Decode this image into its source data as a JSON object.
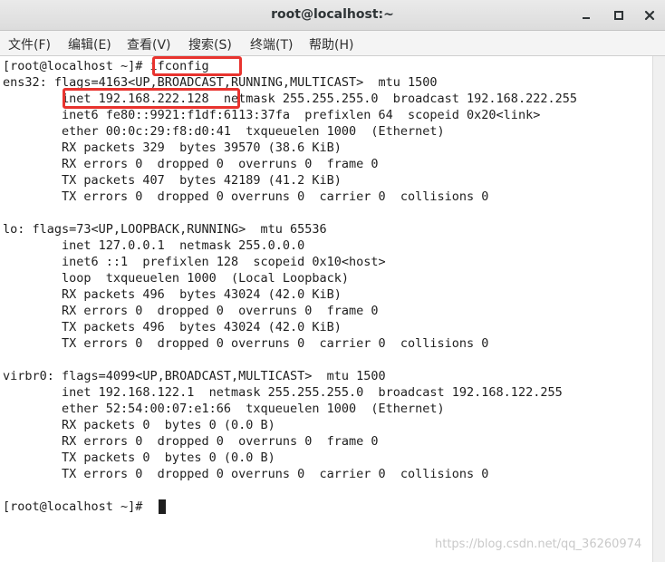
{
  "window": {
    "title": "root@localhost:~",
    "controls": [
      "minimize-icon",
      "maximize-icon",
      "close-icon"
    ]
  },
  "menu": [
    "文件(F)",
    "编辑(E)",
    "查看(V)",
    "搜索(S)",
    "终端(T)",
    "帮助(H)"
  ],
  "terminal": {
    "lines": [
      "[root@localhost ~]# ifconfig",
      "ens32: flags=4163<UP,BROADCAST,RUNNING,MULTICAST>  mtu 1500",
      "        inet 192.168.222.128  netmask 255.255.255.0  broadcast 192.168.222.255",
      "        inet6 fe80::9921:f1df:6113:37fa  prefixlen 64  scopeid 0x20<link>",
      "        ether 00:0c:29:f8:d0:41  txqueuelen 1000  (Ethernet)",
      "        RX packets 329  bytes 39570 (38.6 KiB)",
      "        RX errors 0  dropped 0  overruns 0  frame 0",
      "        TX packets 407  bytes 42189 (41.2 KiB)",
      "        TX errors 0  dropped 0 overruns 0  carrier 0  collisions 0",
      "",
      "lo: flags=73<UP,LOOPBACK,RUNNING>  mtu 65536",
      "        inet 127.0.0.1  netmask 255.0.0.0",
      "        inet6 ::1  prefixlen 128  scopeid 0x10<host>",
      "        loop  txqueuelen 1000  (Local Loopback)",
      "        RX packets 496  bytes 43024 (42.0 KiB)",
      "        RX errors 0  dropped 0  overruns 0  frame 0",
      "        TX packets 496  bytes 43024 (42.0 KiB)",
      "        TX errors 0  dropped 0 overruns 0  carrier 0  collisions 0",
      "",
      "virbr0: flags=4099<UP,BROADCAST,MULTICAST>  mtu 1500",
      "        inet 192.168.122.1  netmask 255.255.255.0  broadcast 192.168.122.255",
      "        ether 52:54:00:07:e1:66  txqueuelen 1000  (Ethernet)",
      "        RX packets 0  bytes 0 (0.0 B)",
      "        RX errors 0  dropped 0  overruns 0  frame 0",
      "        TX packets 0  bytes 0 (0.0 B)",
      "        TX errors 0  dropped 0 overruns 0  carrier 0  collisions 0",
      "",
      "[root@localhost ~]#"
    ],
    "highlighted": [
      "ifconfig",
      "inet 192.168.222.128"
    ],
    "highlight_color": "#e8332e",
    "background": "#ffffff",
    "foreground": "#1e1e1e"
  },
  "watermark": "https://blog.csdn.net/qq_36260974"
}
